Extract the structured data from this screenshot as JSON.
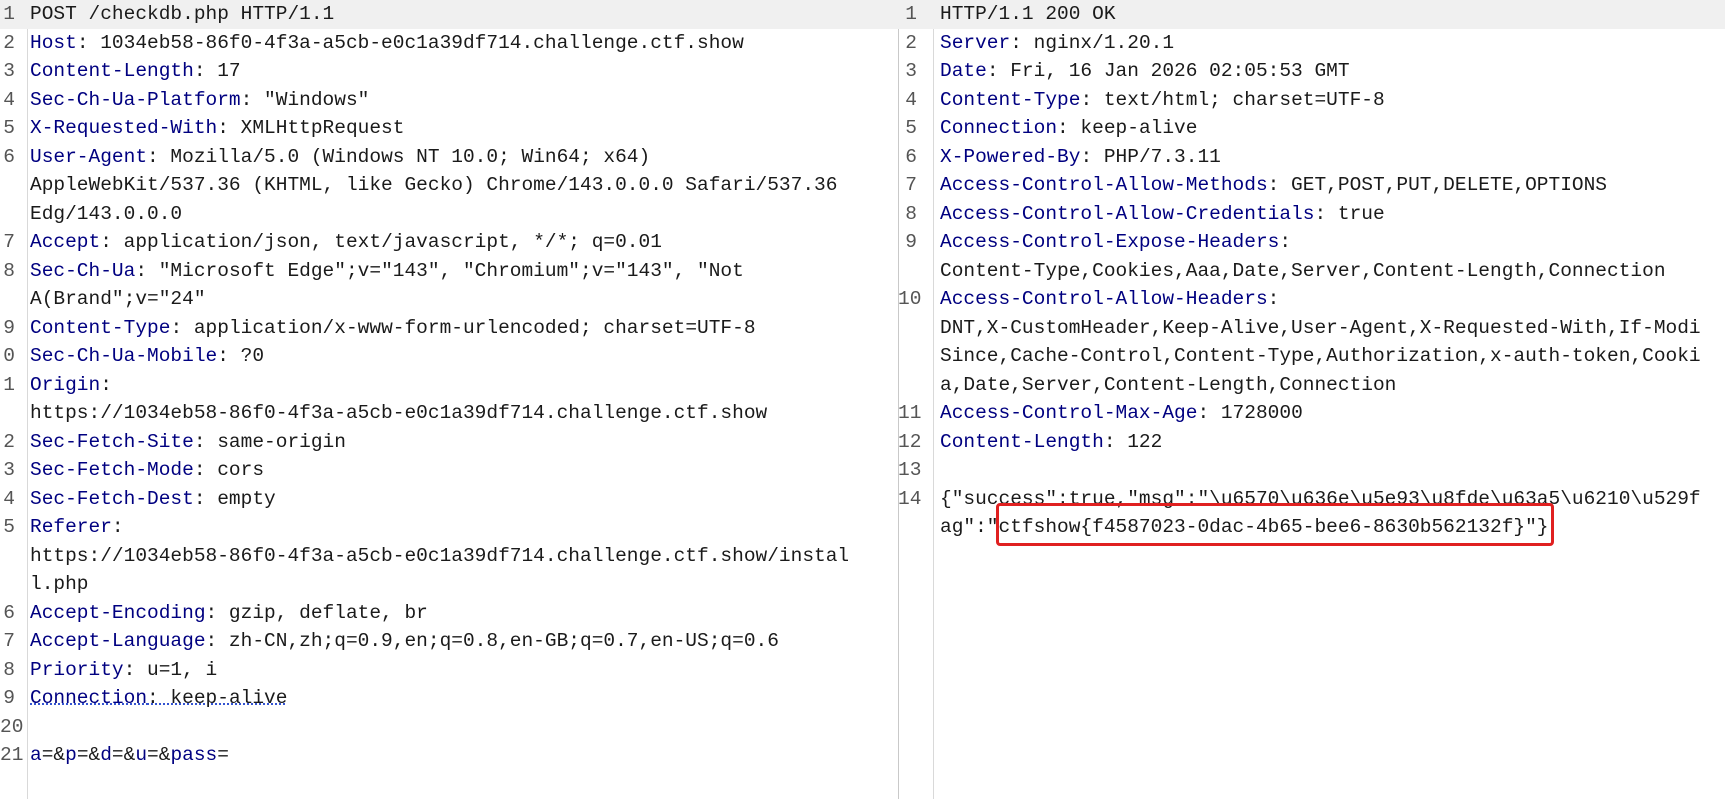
{
  "request": {
    "lines": [
      {
        "num": "1",
        "key": "",
        "value": "POST /checkdb.php HTTP/1.1"
      },
      {
        "num": "2",
        "key": "Host",
        "value": ": 1034eb58-86f0-4f3a-a5cb-e0c1a39df714.challenge.ctf.show"
      },
      {
        "num": "3",
        "key": "Content-Length",
        "value": ": 17"
      },
      {
        "num": "4",
        "key": "Sec-Ch-Ua-Platform",
        "value": ": \"Windows\""
      },
      {
        "num": "5",
        "key": "X-Requested-With",
        "value": ": XMLHttpRequest"
      },
      {
        "num": "6",
        "key": "User-Agent",
        "value": ": Mozilla/5.0 (Windows NT 10.0; Win64; x64)"
      },
      {
        "num": "",
        "key": "",
        "value": "AppleWebKit/537.36 (KHTML, like Gecko) Chrome/143.0.0.0 Safari/537.36"
      },
      {
        "num": "",
        "key": "",
        "value": "Edg/143.0.0.0"
      },
      {
        "num": "7",
        "key": "Accept",
        "value": ": application/json, text/javascript, */*; q=0.01"
      },
      {
        "num": "8",
        "key": "Sec-Ch-Ua",
        "value": ": \"Microsoft Edge\";v=\"143\", \"Chromium\";v=\"143\", \"Not"
      },
      {
        "num": "",
        "key": "",
        "value": "A(Brand\";v=\"24\""
      },
      {
        "num": "9",
        "key": "Content-Type",
        "value": ": application/x-www-form-urlencoded; charset=UTF-8"
      },
      {
        "num": "0",
        "key": "Sec-Ch-Ua-Mobile",
        "value": ": ?0"
      },
      {
        "num": "1",
        "key": "Origin",
        "value": ":"
      },
      {
        "num": "",
        "key": "",
        "value": "https://1034eb58-86f0-4f3a-a5cb-e0c1a39df714.challenge.ctf.show"
      },
      {
        "num": "2",
        "key": "Sec-Fetch-Site",
        "value": ": same-origin"
      },
      {
        "num": "3",
        "key": "Sec-Fetch-Mode",
        "value": ": cors"
      },
      {
        "num": "4",
        "key": "Sec-Fetch-Dest",
        "value": ": empty"
      },
      {
        "num": "5",
        "key": "Referer",
        "value": ":"
      },
      {
        "num": "",
        "key": "",
        "value": "https://1034eb58-86f0-4f3a-a5cb-e0c1a39df714.challenge.ctf.show/instal"
      },
      {
        "num": "",
        "key": "",
        "value": "l.php"
      },
      {
        "num": "6",
        "key": "Accept-Encoding",
        "value": ": gzip, deflate, br"
      },
      {
        "num": "7",
        "key": "Accept-Language",
        "value": ": zh-CN,zh;q=0.9,en;q=0.8,en-GB;q=0.7,en-US;q=0.6"
      },
      {
        "num": "8",
        "key": "Priority",
        "value": ": u=1, i"
      },
      {
        "num": "9",
        "key": "Connection",
        "value": ": keep-alive"
      },
      {
        "num": "20",
        "key": "",
        "value": ""
      },
      {
        "num": "21",
        "key": "",
        "value": ""
      }
    ],
    "body_params": [
      {
        "key": "a",
        "sep": "=&"
      },
      {
        "key": "p",
        "sep": "=&"
      },
      {
        "key": "d",
        "sep": "=&"
      },
      {
        "key": "u",
        "sep": "=&"
      },
      {
        "key": "pass",
        "sep": "="
      }
    ]
  },
  "response": {
    "lines": [
      {
        "num": "1",
        "key": "",
        "value": "HTTP/1.1 200 OK"
      },
      {
        "num": "2",
        "key": "Server",
        "value": ": nginx/1.20.1"
      },
      {
        "num": "3",
        "key": "Date",
        "value": ": Fri, 16 Jan 2026 02:05:53 GMT"
      },
      {
        "num": "4",
        "key": "Content-Type",
        "value": ": text/html; charset=UTF-8"
      },
      {
        "num": "5",
        "key": "Connection",
        "value": ": keep-alive"
      },
      {
        "num": "6",
        "key": "X-Powered-By",
        "value": ": PHP/7.3.11"
      },
      {
        "num": "7",
        "key": "Access-Control-Allow-Methods",
        "value": ": GET,POST,PUT,DELETE,OPTIONS"
      },
      {
        "num": "8",
        "key": "Access-Control-Allow-Credentials",
        "value": ": true"
      },
      {
        "num": "9",
        "key": "Access-Control-Expose-Headers",
        "value": ":"
      },
      {
        "num": "",
        "key": "",
        "value": "Content-Type,Cookies,Aaa,Date,Server,Content-Length,Connection"
      },
      {
        "num": "10",
        "key": "Access-Control-Allow-Headers",
        "value": ":"
      },
      {
        "num": "",
        "key": "",
        "value": "DNT,X-CustomHeader,Keep-Alive,User-Agent,X-Requested-With,If-Modi"
      },
      {
        "num": "",
        "key": "",
        "value": "Since,Cache-Control,Content-Type,Authorization,x-auth-token,Cooki"
      },
      {
        "num": "",
        "key": "",
        "value": "a,Date,Server,Content-Length,Connection"
      },
      {
        "num": "11",
        "key": "Access-Control-Max-Age",
        "value": ": 1728000"
      },
      {
        "num": "12",
        "key": "Content-Length",
        "value": ": 122"
      },
      {
        "num": "13",
        "key": "",
        "value": ""
      },
      {
        "num": "14",
        "key": "",
        "value": "{\"success\":true,\"msg\":\"\\u6570\\u636e\\u5e93\\u8fde\\u63a5\\u6210\\u529f"
      },
      {
        "num": "",
        "key": "",
        "value": "ag\":\"ctfshow{f4587023-0dac-4b65-bee6-8630b562132f}\"}"
      }
    ]
  },
  "colors": {
    "header_key": "#000080",
    "highlight_box": "#e02020"
  }
}
